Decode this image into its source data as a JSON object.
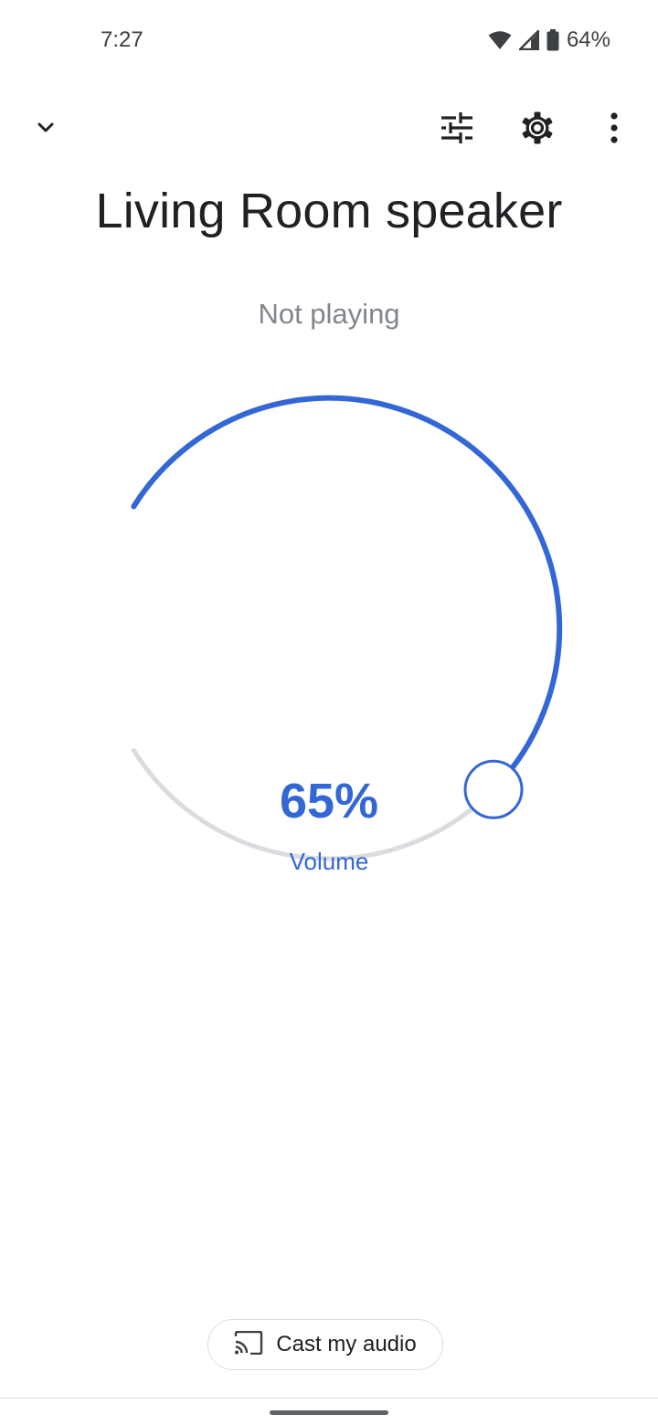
{
  "status_bar": {
    "time": "7:27",
    "battery_percent": "64%",
    "icons": [
      "wifi-icon",
      "cell-signal-icon",
      "battery-icon"
    ]
  },
  "toolbar": {
    "collapse_icon": "chevron-down-icon",
    "equalizer_icon": "equalizer-icon",
    "settings_icon": "gear-icon",
    "more_icon": "more-vert-icon"
  },
  "device": {
    "name": "Living Room speaker",
    "status": "Not playing"
  },
  "volume": {
    "value_text": "65%",
    "value": 0.65,
    "label": "Volume",
    "active_color": "#3367d6",
    "track_color": "#dadce0"
  },
  "cast": {
    "icon": "cast-icon",
    "label": "Cast my audio"
  }
}
